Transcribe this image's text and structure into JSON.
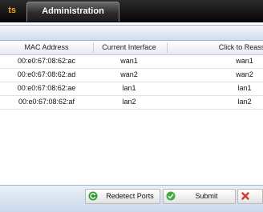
{
  "tabs": {
    "previous_partial": "ts",
    "active": "Administration"
  },
  "table": {
    "columns": [
      "MAC Address",
      "Current Interface",
      "Click to Reassig"
    ],
    "rows": [
      {
        "mac": "00:e0:67:08:62:ac",
        "current": "wan1",
        "reassign": "wan1"
      },
      {
        "mac": "00:e0:67:08:62:ad",
        "current": "wan2",
        "reassign": "wan2"
      },
      {
        "mac": "00:e0:67:08:62:ae",
        "current": "lan1",
        "reassign": "lan1"
      },
      {
        "mac": "00:e0:67:08:62:af",
        "current": "lan2",
        "reassign": "lan2"
      }
    ]
  },
  "buttons": {
    "redetect": "Redetect Ports",
    "submit": "Submit"
  },
  "icons": {
    "redetect": "refresh-icon",
    "submit": "check-icon",
    "cancel": "close-icon"
  },
  "colors": {
    "tab_accent": "#f2a516",
    "refresh_icon": "#2e9a2e",
    "submit_icon": "#3fae3f",
    "cancel_icon": "#d23a2a"
  }
}
